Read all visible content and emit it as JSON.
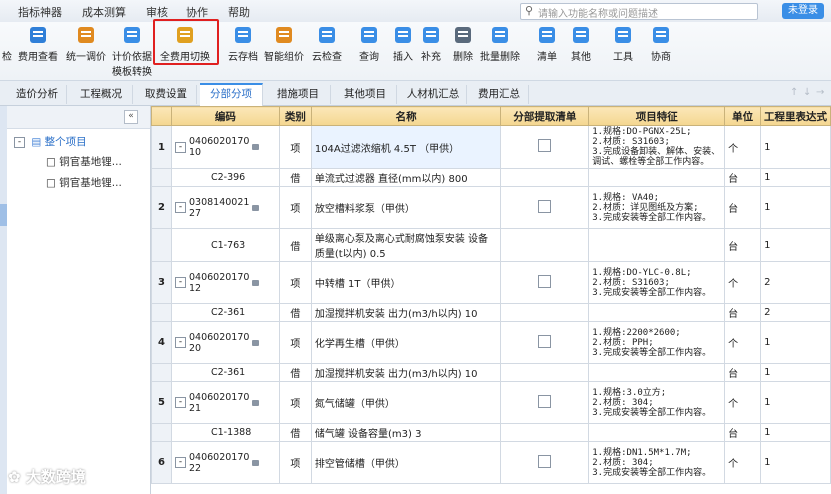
{
  "menu": {
    "items": [
      "指标神器",
      "成本测算",
      "审核",
      "协作",
      "帮助"
    ]
  },
  "search": {
    "placeholder": "请输入功能名称或问题描述"
  },
  "login_label": "未登录",
  "toolbar": {
    "buttons": [
      {
        "label": "检",
        "label2": "",
        "icon": "check-icon"
      },
      {
        "label": "费用查看",
        "label2": "",
        "icon": "cost-view-icon"
      },
      {
        "label": "统一调价",
        "label2": "",
        "icon": "price-adjust-icon"
      },
      {
        "label": "计价依据",
        "label2": "模板转换",
        "icon": "template-convert-icon"
      },
      {
        "label": "全费用切换",
        "label2": "",
        "icon": "full-cost-switch-icon"
      },
      {
        "label": "云存档",
        "label2": "",
        "icon": "cloud-save-icon"
      },
      {
        "label": "智能组价",
        "label2": "",
        "icon": "smart-price-icon"
      },
      {
        "label": "云检查",
        "label2": "",
        "icon": "cloud-check-icon"
      },
      {
        "label": "查询",
        "label2": "",
        "icon": "query-icon"
      },
      {
        "label": "插入",
        "label2": "",
        "icon": "insert-icon"
      },
      {
        "label": "补充",
        "label2": "",
        "icon": "supplement-icon"
      },
      {
        "label": "删除",
        "label2": "",
        "icon": "delete-icon"
      },
      {
        "label": "批量删除",
        "label2": "",
        "icon": "batch-delete-icon"
      },
      {
        "label": "清单",
        "label2": "",
        "icon": "list-icon"
      },
      {
        "label": "其他",
        "label2": "",
        "icon": "other-icon"
      },
      {
        "label": "工具",
        "label2": "",
        "icon": "tools-icon"
      },
      {
        "label": "协商",
        "label2": "",
        "icon": "negotiate-icon"
      }
    ]
  },
  "tabs": [
    "造价分析",
    "工程概况",
    "取费设置",
    "分部分项",
    "措施项目",
    "其他项目",
    "人材机汇总",
    "费用汇总"
  ],
  "active_tab": "分部分项",
  "tree": {
    "root": "整个项目",
    "children": [
      "铜官基地锂...",
      "铜官基地锂..."
    ]
  },
  "grid": {
    "headers": [
      "编码",
      "类别",
      "名称",
      "分部提取清单",
      "项目特征",
      "单位",
      "工程里表达式"
    ],
    "rows": [
      {
        "type": "main",
        "num": "1",
        "code": "0406020170\n10",
        "cat": "项",
        "name": "104A过滤浓缩机 4.5T （甲供）",
        "feat": "1.规格:DO-PGNX-25L;\n2.材质: S31603;\n3.完成设备卸装、解体、安装、调试、螺栓等全部工作内容。",
        "unit": "个",
        "expr": "1"
      },
      {
        "type": "sub",
        "code": "C2-396",
        "cat": "借",
        "name": "单流式过滤器 直径(mm以内) 800",
        "feat": "",
        "unit": "台",
        "expr": "1"
      },
      {
        "type": "main",
        "num": "2",
        "code": "0308140021\n27",
        "cat": "项",
        "name": "放空槽料浆泵（甲供）",
        "feat": "1.规格: VA40;\n2.材质：详见图纸及方案;\n3.完成安装等全部工作内容。",
        "unit": "台",
        "expr": "1"
      },
      {
        "type": "sub",
        "code": "C1-763",
        "cat": "借",
        "name": "单级离心泵及离心式耐腐蚀泵安装 设备质量(t以内) 0.5",
        "feat": "",
        "unit": "台",
        "expr": "1"
      },
      {
        "type": "main",
        "num": "3",
        "code": "0406020170\n12",
        "cat": "项",
        "name": "中转槽 1T（甲供）",
        "feat": "1.规格:DO-YLC-0.8L;\n2.材质: S31603;\n3.完成安装等全部工作内容。",
        "unit": "个",
        "expr": "2"
      },
      {
        "type": "sub",
        "code": "C2-361",
        "cat": "借",
        "name": "加湿搅拌机安装 出力(m3/h以内) 10",
        "feat": "",
        "unit": "台",
        "expr": "2"
      },
      {
        "type": "main",
        "num": "4",
        "code": "0406020170\n20",
        "cat": "项",
        "name": "化学再生槽（甲供）",
        "feat": "1.规格:2200*2600;\n2.材质: PPH;\n3.完成安装等全部工作内容。",
        "unit": "个",
        "expr": "1"
      },
      {
        "type": "sub",
        "code": "C2-361",
        "cat": "借",
        "name": "加湿搅拌机安装 出力(m3/h以内) 10",
        "feat": "",
        "unit": "台",
        "expr": "1"
      },
      {
        "type": "main",
        "num": "5",
        "code": "0406020170\n21",
        "cat": "项",
        "name": "氮气储罐（甲供）",
        "feat": "1.规格:3.0立方;\n2.材质: 304;\n3.完成安装等全部工作内容。",
        "unit": "个",
        "expr": "1"
      },
      {
        "type": "sub",
        "code": "C1-1388",
        "cat": "借",
        "name": "储气罐 设备容量(m3) 3",
        "feat": "",
        "unit": "台",
        "expr": "1"
      },
      {
        "type": "main",
        "num": "6",
        "code": "0406020170\n22",
        "cat": "项",
        "name": "排空管储槽（甲供）",
        "feat": "1.规格:DN1.5M*1.7M;\n2.材质: 304;\n3.完成安装等全部工作内容。",
        "unit": "个",
        "expr": "1"
      }
    ]
  },
  "watermark": "大数跨境"
}
